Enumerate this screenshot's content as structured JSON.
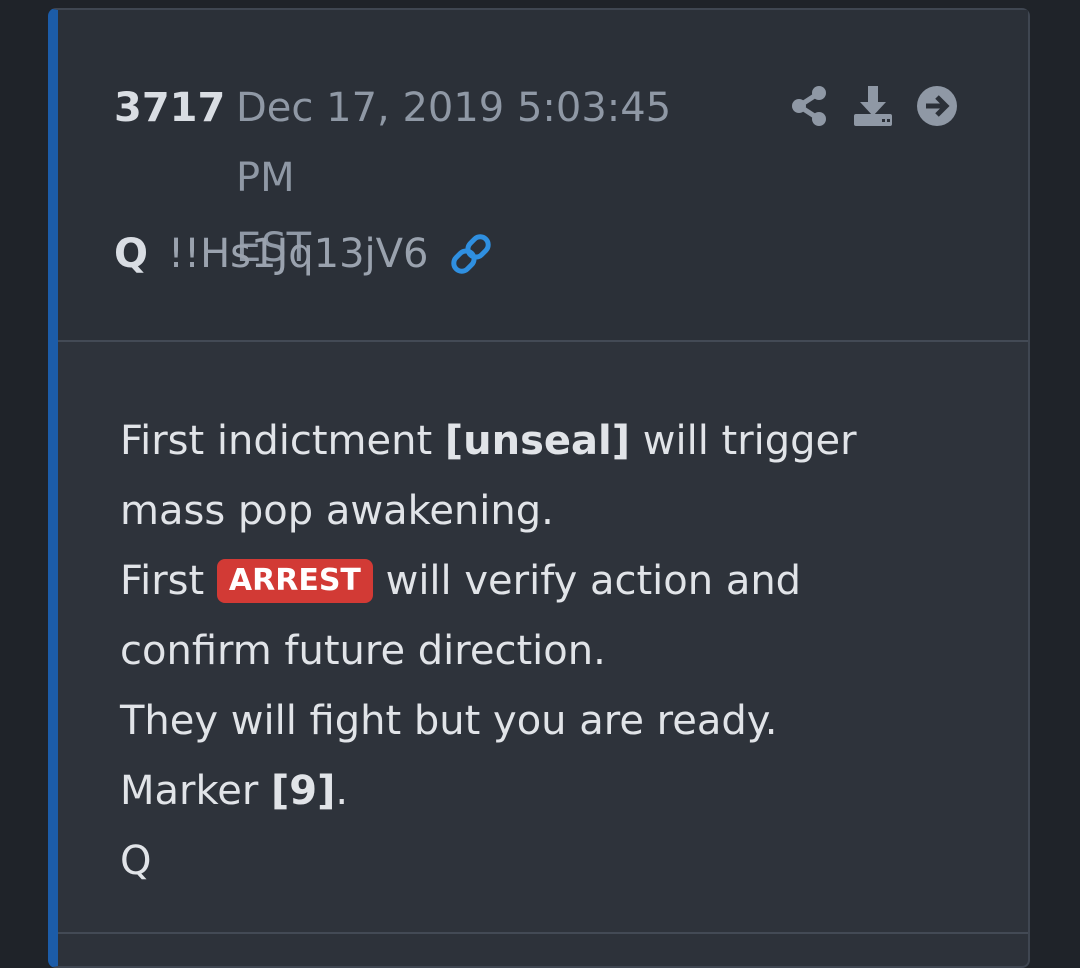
{
  "post": {
    "number": "3717",
    "date_line1": "Dec 17, 2019 5:03:45 PM",
    "date_line2": "EST",
    "author": "Q",
    "tripcode": "!!Hs1Jq13jV6",
    "icons": [
      "share-icon",
      "download-icon",
      "arrow-right-circle-icon",
      "link-icon"
    ]
  },
  "message": {
    "line1_a": "First indictment ",
    "line1_bold": "[unseal]",
    "line1_b": " will trigger mass pop awakening.",
    "line2_a": "First ",
    "line2_badge": "ARREST",
    "line2_b": " will verify action and confirm future direction.",
    "line3": "They will fight but you are ready.",
    "line4_a": "Marker ",
    "line4_bold": "[9]",
    "line4_b": ".",
    "signature": "Q"
  },
  "colors": {
    "accent_blue": "#1c5ca8",
    "link_blue": "#2f8fe0",
    "badge_red": "#d23a35",
    "card_bg": "#2d323a"
  }
}
